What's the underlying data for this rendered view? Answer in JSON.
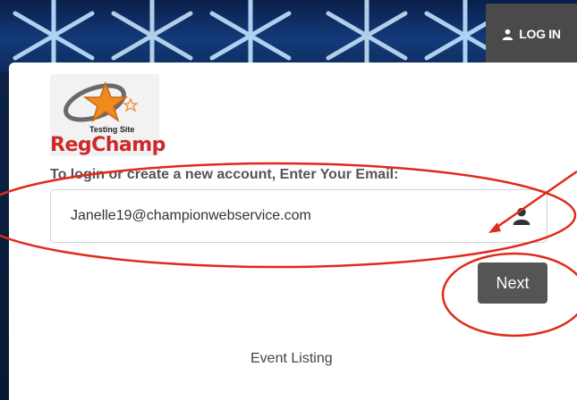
{
  "header": {
    "login_label": "LOG IN",
    "login_icon": "user-icon"
  },
  "logo": {
    "wordmark": "RegChamp",
    "subtitle": "Testing Site"
  },
  "form": {
    "prompt": "To login or create a new account, Enter Your Email:",
    "email_value": "Janelle19@championwebservice.com",
    "email_icon": "user-icon",
    "next_label": "Next"
  },
  "footer": {
    "event_listing_label": "Event Listing"
  },
  "colors": {
    "annotation_red": "#e02a1a",
    "button_gray": "#555555",
    "brand_red": "#cc2a2a"
  }
}
